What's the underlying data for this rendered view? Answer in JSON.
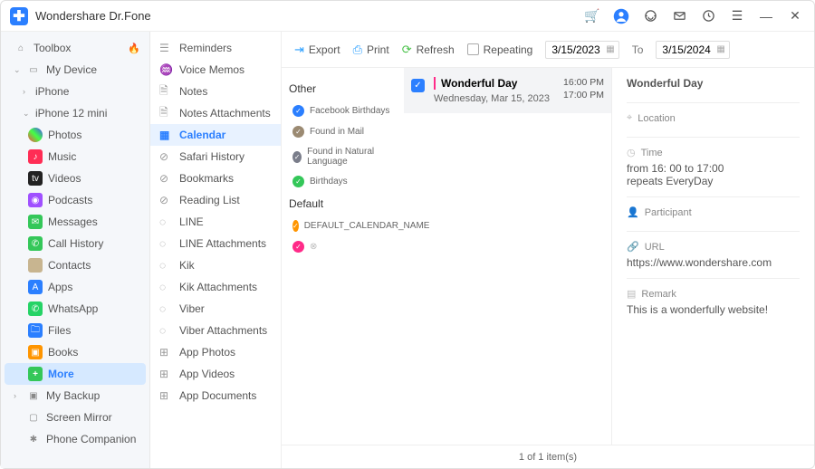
{
  "app": {
    "title": "Wondershare Dr.Fone"
  },
  "sidebar": {
    "toolbox": "Toolbox",
    "my_device": "My Device",
    "iphone": "iPhone",
    "iphone12": "iPhone 12 mini",
    "photos": "Photos",
    "music": "Music",
    "videos": "Videos",
    "podcasts": "Podcasts",
    "messages": "Messages",
    "callhistory": "Call History",
    "contacts": "Contacts",
    "apps": "Apps",
    "whatsapp": "WhatsApp",
    "files": "Files",
    "books": "Books",
    "more": "More",
    "mybackup": "My Backup",
    "screenmirror": "Screen Mirror",
    "phonecompanion": "Phone Companion"
  },
  "col2": {
    "reminders": "Reminders",
    "voicememos": "Voice Memos",
    "notes": "Notes",
    "notes_att": "Notes Attachments",
    "calendar": "Calendar",
    "safari": "Safari History",
    "bookmarks": "Bookmarks",
    "readinglist": "Reading List",
    "line": "LINE",
    "line_att": "LINE Attachments",
    "kik": "Kik",
    "kik_att": "Kik Attachments",
    "viber": "Viber",
    "viber_att": "Viber Attachments",
    "app_photos": "App Photos",
    "app_videos": "App Videos",
    "app_docs": "App Documents"
  },
  "toolbar": {
    "export": "Export",
    "print": "Print",
    "refresh": "Refresh",
    "repeating": "Repeating",
    "date_from": "3/15/2023",
    "to": "To",
    "date_to": "3/15/2024"
  },
  "calendars": {
    "group_other": "Other",
    "fb": "Facebook Birthdays",
    "mail": "Found in Mail",
    "nl": "Found in Natural Language",
    "bday": "Birthdays",
    "group_default": "Default",
    "defcal": "DEFAULT_CALENDAR_NAME"
  },
  "event": {
    "title": "Wonderful Day",
    "date": "Wednesday, Mar 15, 2023",
    "t1": "16:00 PM",
    "t2": "17:00 PM"
  },
  "details": {
    "title": "Wonderful Day",
    "location_label": "Location",
    "time_label": "Time",
    "time_value": "from 16: 00 to 17:00",
    "repeats": "repeats EveryDay",
    "participant_label": "Participant",
    "url_label": "URL",
    "url_value": "https://www.wondershare.com",
    "remark_label": "Remark",
    "remark_value": "This is a wonderfully website!"
  },
  "footer": "1  of  1 item(s)"
}
